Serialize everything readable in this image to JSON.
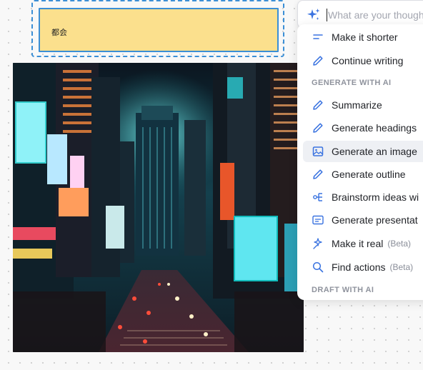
{
  "canvas": {
    "sticky_note_text": "都会"
  },
  "ai_menu": {
    "prompt_placeholder": "What are your thoughts?",
    "items_top": [
      {
        "label": "Make it shorter",
        "icon": "shorten-lines-icon"
      },
      {
        "label": "Continue writing",
        "icon": "pencil-icon"
      }
    ],
    "section_generate": "GENERATE WITH AI",
    "items_generate": [
      {
        "label": "Summarize",
        "icon": "pencil-icon"
      },
      {
        "label": "Generate headings",
        "icon": "pencil-icon"
      },
      {
        "label": "Generate an image",
        "icon": "image-icon"
      },
      {
        "label": "Generate outline",
        "icon": "pencil-icon"
      },
      {
        "label": "Brainstorm ideas wi",
        "icon": "mindmap-icon"
      },
      {
        "label": "Generate presentat",
        "icon": "presentation-icon"
      },
      {
        "label": "Make it real",
        "badge": "(Beta)",
        "icon": "magic-wand-icon"
      },
      {
        "label": "Find actions",
        "badge": "(Beta)",
        "icon": "search-icon"
      }
    ],
    "section_draft": "DRAFT WITH AI"
  },
  "colors": {
    "selection_blue": "#3b8fd6",
    "sticky_yellow": "#fbe08d",
    "accent_blue": "#3a73e0"
  }
}
